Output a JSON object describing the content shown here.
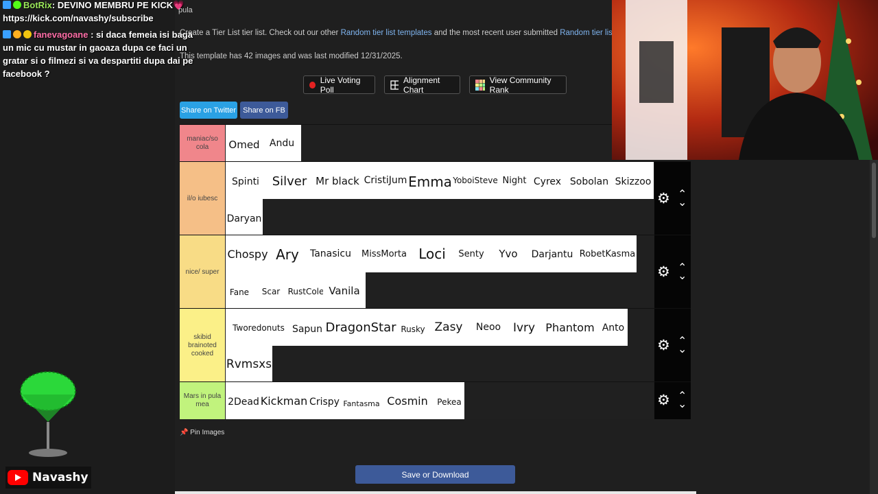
{
  "chat": [
    {
      "user": "BotRix",
      "user_color": "#9be85a",
      "message": ": DEVINO MEMBRU PE KICK",
      "heart": "💗",
      "line2": "https://kick.com/navashy/subscribe"
    },
    {
      "user": "fanevagoane",
      "user_color": "#ff6fa8",
      "message": " : si daca femeia isi baga",
      "lines": [
        "un mic cu mustar in gaoaza dupa ce faci un",
        "gratar si o filmezi si va despartiti dupa dai pe",
        "facebook ?"
      ]
    }
  ],
  "page": {
    "title": "pula",
    "intro_prefix": "Create a Tier List tier list. Check out our other ",
    "intro_link1": "Random tier list templates",
    "intro_mid": " and the most recent user submitted ",
    "intro_link2": "Random tier lists",
    "meta": "This template has 42 images and was last modified 12/31/2025."
  },
  "actions": {
    "live_voting": "Live Voting Poll",
    "alignment": "Alignment Chart",
    "community": "View Community Rank",
    "share_twitter": "Share on Twitter",
    "share_fb": "Share on FB"
  },
  "tiers": [
    {
      "label": "maniac/so cola",
      "color": "#f0868b",
      "items": [
        "Omed",
        "Andu"
      ]
    },
    {
      "label": "il/o iubesc",
      "color": "#f5bf87",
      "items": [
        "Spinti",
        "Silver",
        "Mr black",
        "CristiJum",
        "Emma",
        "YoboiSteve",
        "Night",
        "Cyrex",
        "Sobolan",
        "Skizzoo",
        "Daryan"
      ]
    },
    {
      "label": "nice/ super",
      "color": "#f8dc86",
      "items": [
        "Chospy",
        "Ary",
        "Tanasicu",
        "MissMorta",
        "Loci",
        "Senty",
        "Yvo",
        "Darjantu",
        "RobetKasma",
        "Fane",
        "Scar",
        "RustCole",
        "Vanila"
      ]
    },
    {
      "label": "skibid brainoted cooked",
      "color": "#fbf088",
      "items": [
        "Tworedonuts",
        "Sapun",
        "DragonStar",
        "Rusky",
        "Zasy",
        "Neoo",
        "Ivry",
        "Phantom",
        "Anto",
        "Rvmsxs"
      ]
    },
    {
      "label": "Mars in pula mea",
      "color": "#c1f37d",
      "items": [
        "2Dead",
        "Kickman",
        "Crispy",
        "Fantasma",
        "Cosmin",
        "Pekea"
      ]
    }
  ],
  "pin_label": "Pin Images",
  "save_label": "Save or Download",
  "streamer": {
    "name": "Navashy"
  }
}
